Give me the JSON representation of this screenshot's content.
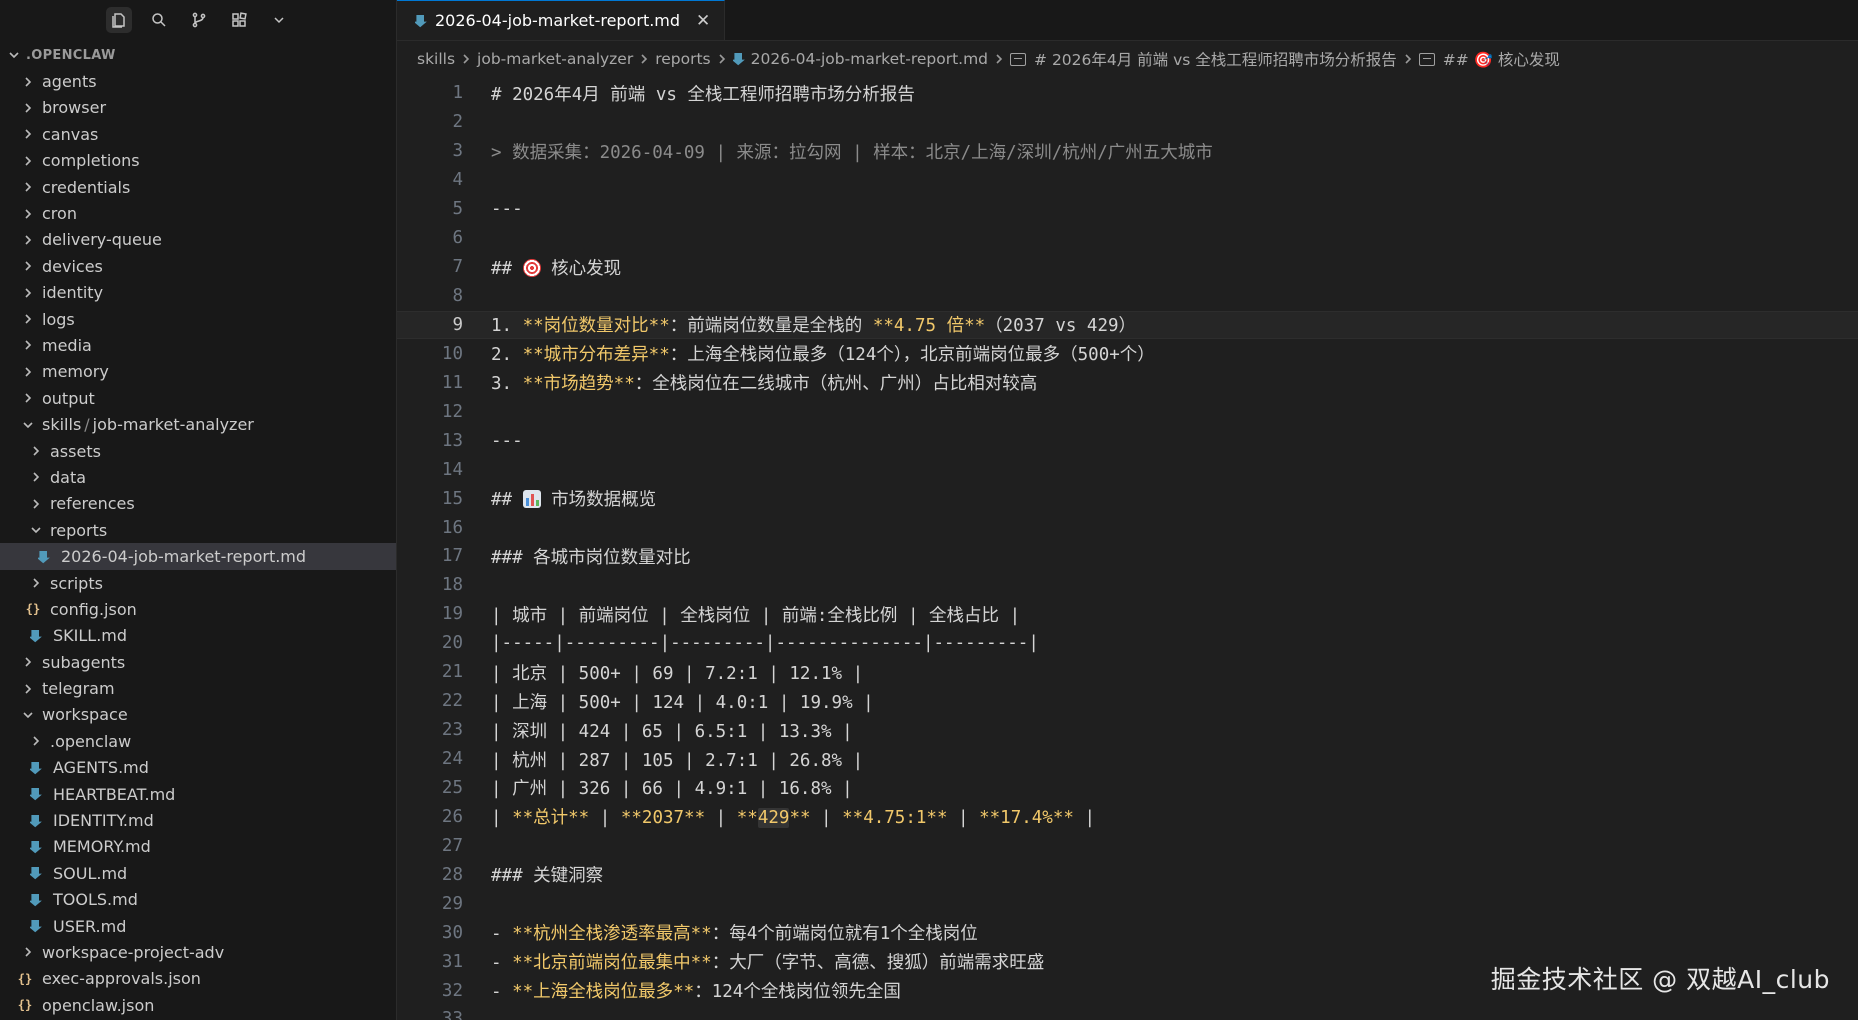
{
  "sidebar": {
    "toolbar_icons": [
      "files-icon",
      "search-icon",
      "source-control-icon",
      "extensions-icon",
      "chevron-down-icon"
    ],
    "root_label": ".OPENCLAW",
    "items": [
      {
        "label": "agents",
        "type": "folder",
        "depth": 1,
        "expanded": false
      },
      {
        "label": "browser",
        "type": "folder",
        "depth": 1,
        "expanded": false
      },
      {
        "label": "canvas",
        "type": "folder",
        "depth": 1,
        "expanded": false
      },
      {
        "label": "completions",
        "type": "folder",
        "depth": 1,
        "expanded": false
      },
      {
        "label": "credentials",
        "type": "folder",
        "depth": 1,
        "expanded": false
      },
      {
        "label": "cron",
        "type": "folder",
        "depth": 1,
        "expanded": false
      },
      {
        "label": "delivery-queue",
        "type": "folder",
        "depth": 1,
        "expanded": false
      },
      {
        "label": "devices",
        "type": "folder",
        "depth": 1,
        "expanded": false
      },
      {
        "label": "identity",
        "type": "folder",
        "depth": 1,
        "expanded": false
      },
      {
        "label": "logs",
        "type": "folder",
        "depth": 1,
        "expanded": false
      },
      {
        "label": "media",
        "type": "folder",
        "depth": 1,
        "expanded": false
      },
      {
        "label": "memory",
        "type": "folder",
        "depth": 1,
        "expanded": false
      },
      {
        "label": "output",
        "type": "folder",
        "depth": 1,
        "expanded": false
      },
      {
        "label": "skills",
        "label2": "job-market-analyzer",
        "type": "folder-compact",
        "depth": 1,
        "expanded": true
      },
      {
        "label": "assets",
        "type": "folder",
        "depth": 2,
        "expanded": false
      },
      {
        "label": "data",
        "type": "folder",
        "depth": 2,
        "expanded": false
      },
      {
        "label": "references",
        "type": "folder",
        "depth": 2,
        "expanded": false
      },
      {
        "label": "reports",
        "type": "folder",
        "depth": 2,
        "expanded": true
      },
      {
        "label": "2026-04-job-market-report.md",
        "type": "md",
        "depth": 3,
        "selected": true
      },
      {
        "label": "scripts",
        "type": "folder",
        "depth": 2,
        "expanded": false
      },
      {
        "label": "config.json",
        "type": "json",
        "depth": 2
      },
      {
        "label": "SKILL.md",
        "type": "md",
        "depth": 2
      },
      {
        "label": "subagents",
        "type": "folder",
        "depth": 1,
        "expanded": false
      },
      {
        "label": "telegram",
        "type": "folder",
        "depth": 1,
        "expanded": false
      },
      {
        "label": "workspace",
        "type": "folder",
        "depth": 1,
        "expanded": true
      },
      {
        "label": ".openclaw",
        "type": "folder",
        "depth": 2,
        "expanded": false
      },
      {
        "label": "AGENTS.md",
        "type": "md",
        "depth": 2
      },
      {
        "label": "HEARTBEAT.md",
        "type": "md",
        "depth": 2
      },
      {
        "label": "IDENTITY.md",
        "type": "md",
        "depth": 2
      },
      {
        "label": "MEMORY.md",
        "type": "md",
        "depth": 2
      },
      {
        "label": "SOUL.md",
        "type": "md",
        "depth": 2
      },
      {
        "label": "TOOLS.md",
        "type": "md",
        "depth": 2
      },
      {
        "label": "USER.md",
        "type": "md",
        "depth": 2
      },
      {
        "label": "workspace-project-adv",
        "type": "folder",
        "depth": 1,
        "expanded": false
      },
      {
        "label": "exec-approvals.json",
        "type": "json",
        "depth": 1
      },
      {
        "label": "openclaw.json",
        "type": "json",
        "depth": 1
      }
    ]
  },
  "tab": {
    "title": "2026-04-job-market-report.md",
    "close_glyph": "✕"
  },
  "breadcrumb": {
    "parts": [
      "skills",
      "job-market-analyzer",
      "reports"
    ],
    "file": "2026-04-job-market-report.md",
    "symbols": [
      "# 2026年4月 前端 vs 全栈工程师招聘市场分析报告",
      "## 🎯 核心发现"
    ]
  },
  "editor": {
    "current_line": 9,
    "lines": [
      {
        "n": "1",
        "segs": [
          {
            "t": "# 2026年4月 前端 vs 全栈工程师招聘市场分析报告",
            "c": "head"
          }
        ]
      },
      {
        "n": "2",
        "segs": []
      },
      {
        "n": "3",
        "segs": [
          {
            "t": "> 数据采集：2026-04-09 | 来源：拉勾网 | 样本：北京/上海/深圳/杭州/广州五大城市",
            "c": "quote"
          }
        ]
      },
      {
        "n": "4",
        "segs": []
      },
      {
        "n": "5",
        "segs": [
          {
            "t": "---",
            "c": "hr"
          }
        ]
      },
      {
        "n": "6",
        "segs": []
      },
      {
        "n": "7",
        "segs": [
          {
            "t": "## ",
            "c": "head"
          },
          {
            "t": "🎯",
            "c": "emoji-target"
          },
          {
            "t": " 核心发现",
            "c": "head"
          }
        ]
      },
      {
        "n": "8",
        "segs": []
      },
      {
        "n": "9",
        "segs": [
          {
            "t": "1. ",
            "c": "plain"
          },
          {
            "t": "**岗位数量对比**",
            "c": "bold"
          },
          {
            "t": "：前端岗位数量是全栈的 ",
            "c": "plain"
          },
          {
            "t": "**4.75 倍**",
            "c": "bold"
          },
          {
            "t": "（2037 vs 429）",
            "c": "plain"
          }
        ]
      },
      {
        "n": "10",
        "segs": [
          {
            "t": "2. ",
            "c": "plain"
          },
          {
            "t": "**城市分布差异**",
            "c": "bold"
          },
          {
            "t": "：上海全栈岗位最多（124个），北京前端岗位最多（500+个）",
            "c": "plain"
          }
        ]
      },
      {
        "n": "11",
        "segs": [
          {
            "t": "3. ",
            "c": "plain"
          },
          {
            "t": "**市场趋势**",
            "c": "bold"
          },
          {
            "t": "：全栈岗位在二线城市（杭州、广州）占比相对较高",
            "c": "plain"
          }
        ]
      },
      {
        "n": "12",
        "segs": []
      },
      {
        "n": "13",
        "segs": [
          {
            "t": "---",
            "c": "hr"
          }
        ]
      },
      {
        "n": "14",
        "segs": []
      },
      {
        "n": "15",
        "segs": [
          {
            "t": "## ",
            "c": "head"
          },
          {
            "t": "📊",
            "c": "emoji-chart"
          },
          {
            "t": " 市场数据概览",
            "c": "head"
          }
        ]
      },
      {
        "n": "16",
        "segs": []
      },
      {
        "n": "17",
        "segs": [
          {
            "t": "### 各城市岗位数量对比",
            "c": "head"
          }
        ]
      },
      {
        "n": "18",
        "segs": []
      },
      {
        "n": "19",
        "segs": [
          {
            "t": "| 城市 | 前端岗位 | 全栈岗位 | 前端:全栈比例 | 全栈占比 |",
            "c": "plain"
          }
        ]
      },
      {
        "n": "20",
        "segs": [
          {
            "t": "|-----|---------|---------|--------------|---------|",
            "c": "plain"
          }
        ]
      },
      {
        "n": "21",
        "segs": [
          {
            "t": "| 北京 | 500+ | 69 | 7.2:1 | 12.1% |",
            "c": "plain"
          }
        ]
      },
      {
        "n": "22",
        "segs": [
          {
            "t": "| 上海 | 500+ | 124 | 4.0:1 | 19.9% |",
            "c": "plain"
          }
        ]
      },
      {
        "n": "23",
        "segs": [
          {
            "t": "| 深圳 | 424 | 65 | 6.5:1 | 13.3% |",
            "c": "plain"
          }
        ]
      },
      {
        "n": "24",
        "segs": [
          {
            "t": "| 杭州 | 287 | 105 | 2.7:1 | 26.8% |",
            "c": "plain"
          }
        ]
      },
      {
        "n": "25",
        "segs": [
          {
            "t": "| 广州 | 326 | 66 | 4.9:1 | 16.8% |",
            "c": "plain"
          }
        ]
      },
      {
        "n": "26",
        "segs": [
          {
            "t": "| ",
            "c": "plain"
          },
          {
            "t": "**总计**",
            "c": "bold"
          },
          {
            "t": " | ",
            "c": "plain"
          },
          {
            "t": "**2037**",
            "c": "bold"
          },
          {
            "t": " | ",
            "c": "plain"
          },
          {
            "t": "**",
            "c": "bold"
          },
          {
            "t": "429",
            "c": "bold-hl"
          },
          {
            "t": "**",
            "c": "bold"
          },
          {
            "t": " | ",
            "c": "plain"
          },
          {
            "t": "**4.75:1**",
            "c": "bold"
          },
          {
            "t": " | ",
            "c": "plain"
          },
          {
            "t": "**17.4%**",
            "c": "bold"
          },
          {
            "t": " |",
            "c": "plain"
          }
        ]
      },
      {
        "n": "27",
        "segs": []
      },
      {
        "n": "28",
        "segs": [
          {
            "t": "### 关键洞察",
            "c": "head"
          }
        ]
      },
      {
        "n": "29",
        "segs": []
      },
      {
        "n": "30",
        "segs": [
          {
            "t": "- ",
            "c": "plain"
          },
          {
            "t": "**杭州全栈渗透率最高**",
            "c": "bold"
          },
          {
            "t": "：每4个前端岗位就有1个全栈岗位",
            "c": "plain"
          }
        ]
      },
      {
        "n": "31",
        "segs": [
          {
            "t": "- ",
            "c": "plain"
          },
          {
            "t": "**北京前端岗位最集中**",
            "c": "bold"
          },
          {
            "t": "：大厂（字节、高德、搜狐）前端需求旺盛",
            "c": "plain"
          }
        ]
      },
      {
        "n": "32",
        "segs": [
          {
            "t": "- ",
            "c": "plain"
          },
          {
            "t": "**上海全栈岗位最多**",
            "c": "bold"
          },
          {
            "t": "：124个全栈岗位领先全国",
            "c": "plain"
          }
        ]
      },
      {
        "n": "33",
        "segs": []
      }
    ]
  },
  "watermark": "掘金技术社区 @ 双越AI_club",
  "colors": {
    "bold_text": "#f1c86a",
    "md_icon": "#519aba",
    "json_icon": "#e2c08d",
    "tab_accent": "#0078d4"
  }
}
